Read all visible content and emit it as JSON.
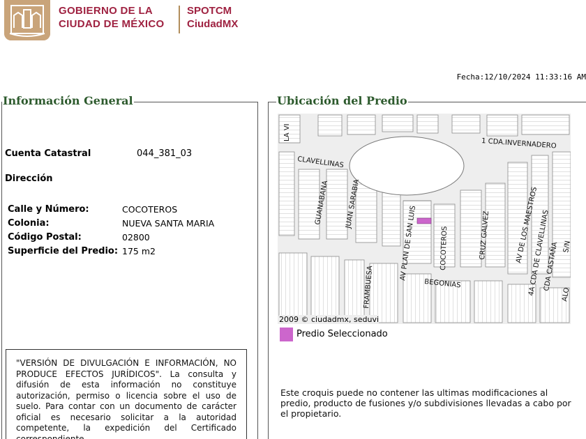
{
  "header": {
    "gov_line1": "GOBIERNO DE LA",
    "gov_line2": "CIUDAD DE MÉXICO",
    "app_line1": "SPOTCM",
    "app_line2": "CiudadMX",
    "brand_color": "#9f2241",
    "emblem_color": "#c9a47a"
  },
  "fecha": "Fecha:12/10/2024 11:33:16 AM",
  "info": {
    "legend": "Información General",
    "cuenta_label": "Cuenta Catastral",
    "cuenta_value": "044_381_03",
    "direccion_label": "Dirección",
    "rows": [
      {
        "key": "Calle y Número:",
        "value": "COCOTEROS"
      },
      {
        "key": "Colonia:",
        "value": "NUEVA SANTA MARIA"
      },
      {
        "key": "Código Postal:",
        "value": "02800"
      },
      {
        "key": "Superficie del Predio:",
        "value": "175 m2"
      }
    ],
    "disclaimer": "\"VERSIÓN DE DIVULGACIÓN E INFORMACIÓN, NO PRODUCE EFECTOS JURÍDICOS\". La consulta y difusión de esta información no constituye autorización, permiso o licencia sobre el uso de suelo. Para contar con un documento de carácter oficial es necesario solicitar a la autoridad competente, la expedición del Certificado correspondiente."
  },
  "map": {
    "legend": "Ubicación del Predio",
    "streets": [
      "LA VI",
      "1 CDA.INVERNADERO",
      "CLAVELLINAS",
      "GUANABANA",
      "JUAN SARABIA",
      "AV PLAN DE SAN LUIS",
      "COCOTEROS",
      "CRUZ GALVEZ",
      "AV DE LOS MAESTROS",
      "4A CDA DE CLAVELLINAS",
      "CDA CASTAÑA",
      "S/N",
      "ALO",
      "FRAMBUESA",
      "BEGONIAS"
    ],
    "copyright": "2009 © ciudadmx, seduvi",
    "legend_label": "Predio Seleccionado",
    "selected_color": "#cc66cc",
    "note": "Este croquis puede no contener las ultimas modificaciones al predio, producto de fusiones y/o subdivisiones llevadas a cabo por el propietario."
  }
}
